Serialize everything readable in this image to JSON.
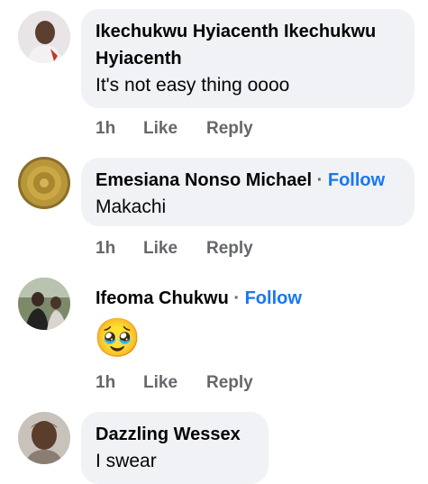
{
  "comments": [
    {
      "author": "Ikechukwu Hyiacenth Ikechukwu Hyiacenth",
      "author_line1": "Ikechukwu Hyiacenth Ikechukwu",
      "author_line2": "Hyiacenth",
      "text": "It's not easy thing oooo",
      "time": "1h",
      "like": "Like",
      "reply": "Reply"
    },
    {
      "author": "Emesiana Nonso Michael",
      "separator": "·",
      "follow": "Follow",
      "text": "Makachi",
      "time": "1h",
      "like": "Like",
      "reply": "Reply"
    },
    {
      "author": "Ifeoma Chukwu",
      "separator": "·",
      "follow": "Follow",
      "emoji": "🥹",
      "time": "1h",
      "like": "Like",
      "reply": "Reply"
    },
    {
      "author": "Dazzling Wessex",
      "text": "I swear"
    }
  ],
  "colors": {
    "bubble": "#f0f2f5",
    "follow": "#1877f2",
    "meta": "#65676b"
  }
}
